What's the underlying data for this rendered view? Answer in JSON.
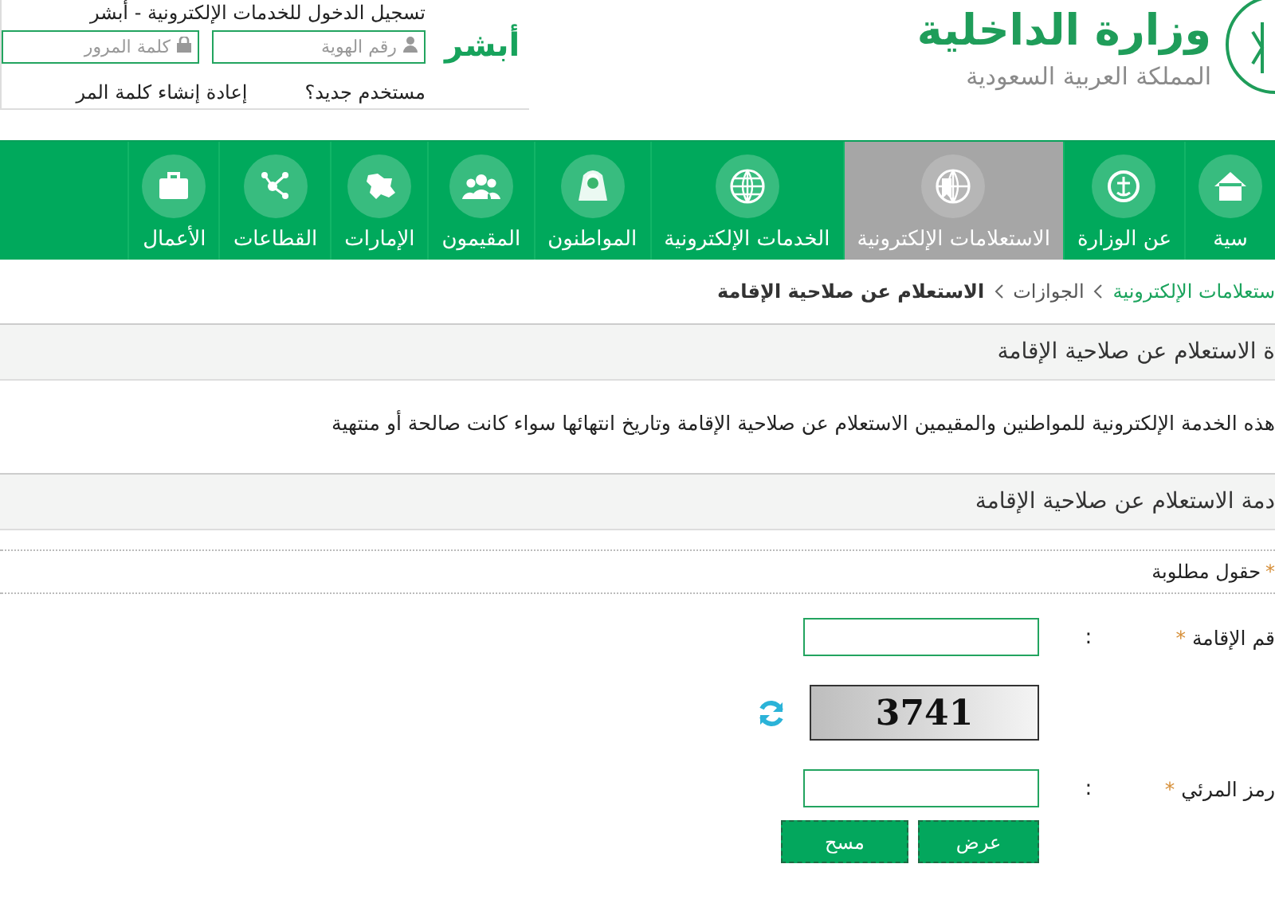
{
  "header": {
    "ministry_name": "وزارة الداخلية",
    "country": "المملكة العربية السعودية",
    "absher_logo": "أبشر",
    "login": {
      "title": "تسجيل الدخول للخدمات الإلكترونية - أبشر",
      "id_placeholder": "رقم الهوية",
      "password_placeholder": "كلمة المرور",
      "new_user_link": "مستخدم جديد؟",
      "reset_link": "إعادة إنشاء كلمة المر"
    }
  },
  "nav": [
    {
      "label": "سية",
      "selected": false
    },
    {
      "label": "عن الوزارة",
      "selected": false
    },
    {
      "label": "الاستعلامات الإلكترونية",
      "selected": true
    },
    {
      "label": "الخدمات الإلكترونية",
      "selected": false
    },
    {
      "label": "المواطنون",
      "selected": false
    },
    {
      "label": "المقيمون",
      "selected": false
    },
    {
      "label": "الإمارات",
      "selected": false
    },
    {
      "label": "القطاعات",
      "selected": false
    },
    {
      "label": "الأعمال",
      "selected": false
    }
  ],
  "breadcrumb": [
    "ستعلامات الإلكترونية",
    "الجوازات",
    "الاستعلام عن صلاحية الإقامة"
  ],
  "page_title": "ة الاستعلام عن صلاحية الإقامة",
  "description": "هذه الخدمة الإلكترونية للمواطنين والمقيمين الاستعلام عن صلاحية الإقامة وتاريخ انتهائها سواء كانت صالحة أو منتهية",
  "form": {
    "title": "دمة الاستعلام عن صلاحية الإقامة",
    "required_note": {
      "mark": "*",
      "text": "حقول مطلوبة"
    },
    "fields": [
      {
        "kind": "text",
        "label": "قم الإقامة",
        "mark": "*",
        "colon": ":"
      },
      {
        "kind": "captcha",
        "code": "3741"
      },
      {
        "kind": "text",
        "label": "رمز المرئي",
        "mark": "*",
        "colon": ":"
      }
    ],
    "buttons": [
      "عرض",
      "مسح"
    ]
  }
}
